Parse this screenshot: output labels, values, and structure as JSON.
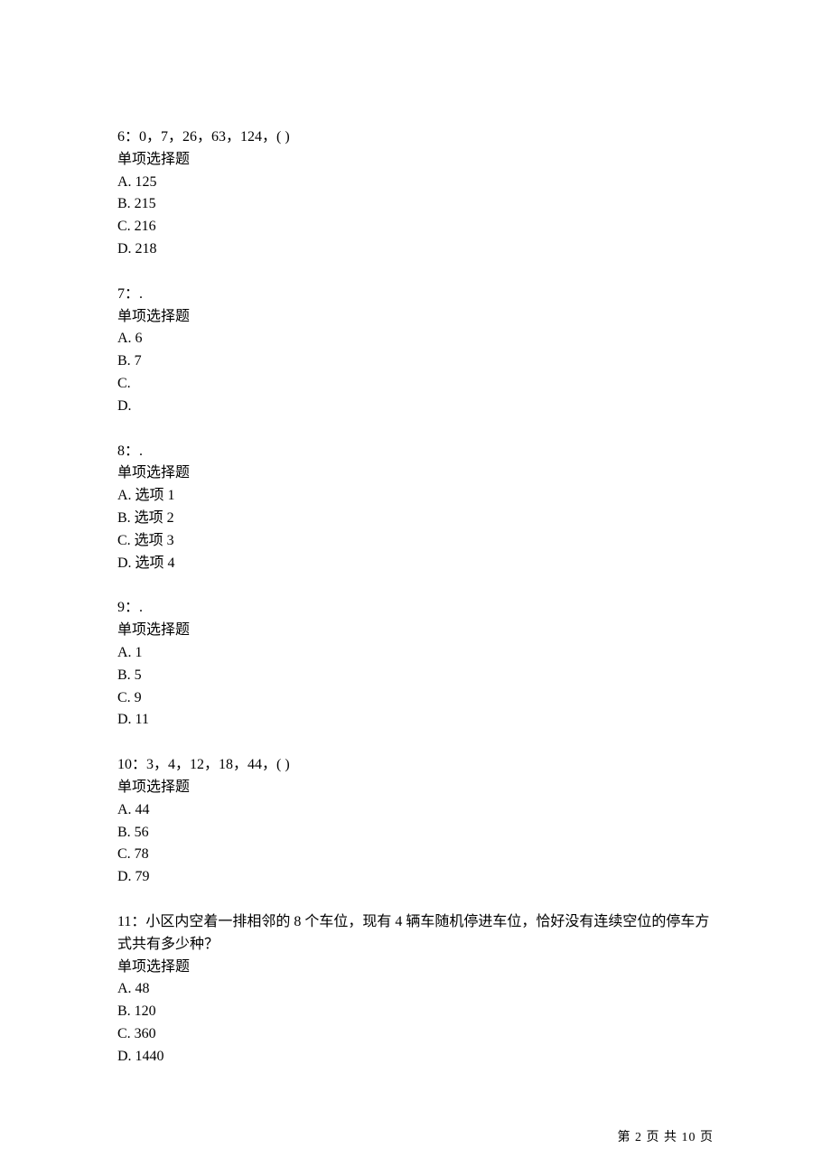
{
  "questions": [
    {
      "num": "6",
      "text": "0，7，26，63，124，(   )",
      "type": "单项选择题",
      "opts": [
        "A.  125",
        "B.  215",
        "C.  216",
        "D.  218"
      ]
    },
    {
      "num": "7",
      "text": ".",
      "type": "单项选择题",
      "opts": [
        "A.  6",
        "B.  7",
        "C.",
        "D."
      ]
    },
    {
      "num": "8",
      "text": ".",
      "type": "单项选择题",
      "opts": [
        "A.  选项 1",
        "B.  选项 2",
        "C.  选项 3",
        "D.  选项 4"
      ]
    },
    {
      "num": "9",
      "text": ".",
      "type": "单项选择题",
      "opts": [
        "A.  1",
        "B.  5",
        "C.  9",
        "D.  11"
      ]
    },
    {
      "num": "10",
      "text": "3，4，12，18，44，(  )",
      "type": "单项选择题",
      "opts": [
        "A.  44",
        "B.  56",
        "C.  78",
        "D.  79"
      ]
    },
    {
      "num": "11",
      "text": "小区内空着一排相邻的 8 个车位，现有 4 辆车随机停进车位，恰好没有连续空位的停车方式共有多少种？",
      "type": "单项选择题",
      "opts": [
        "A.  48",
        "B.  120",
        "C.  360",
        "D.  1440"
      ]
    }
  ],
  "footer": "第 2 页 共 10 页"
}
